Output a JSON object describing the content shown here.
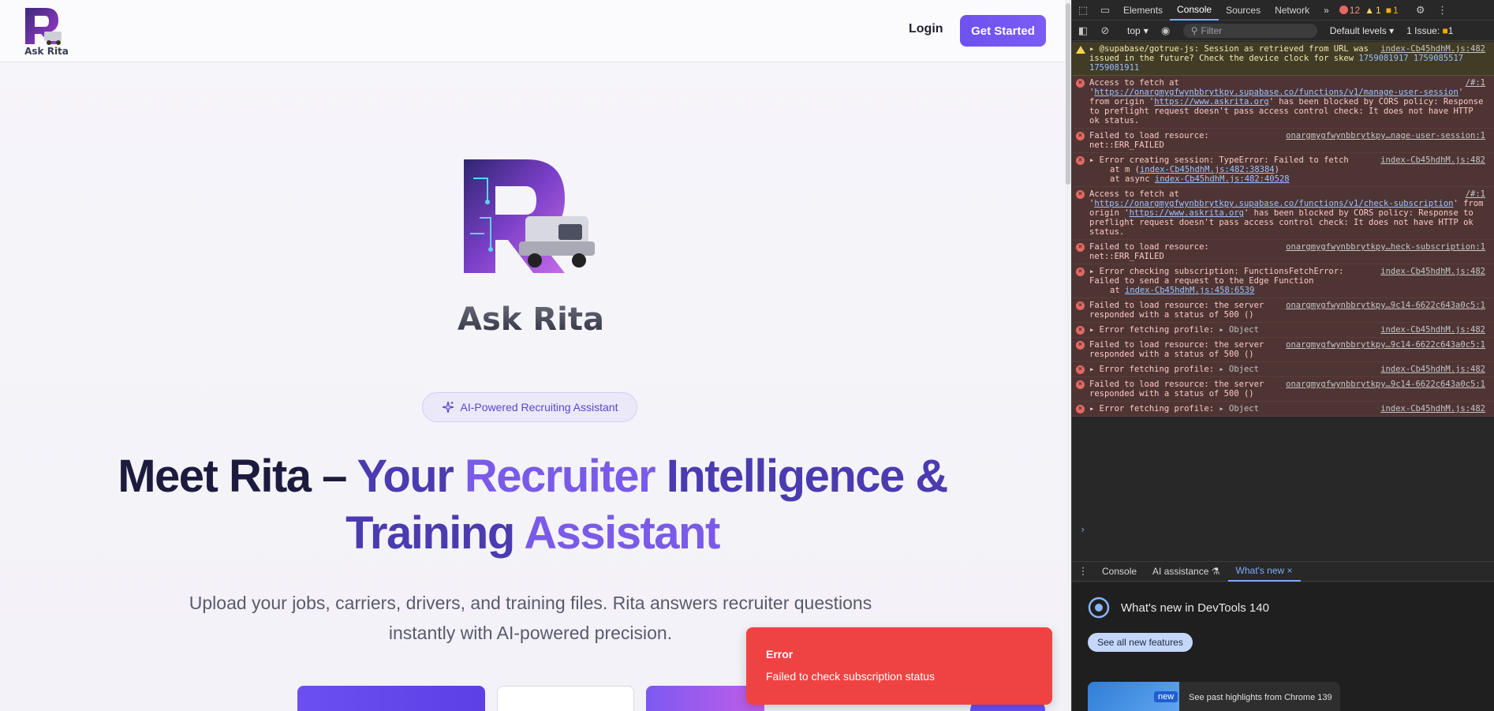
{
  "nav": {
    "logo_text": "Ask Rita",
    "login_label": "Login",
    "get_started_label": "Get Started"
  },
  "hero": {
    "logo_text": "Ask Rita",
    "badge": "AI-Powered Recruiting Assistant",
    "headline_1a": "Meet Rita – ",
    "headline_1b": "Your ",
    "headline_1c": "Recruiter ",
    "headline_1d": "Intelligence &",
    "headline_2a": "Training ",
    "headline_2b": "Assistant",
    "subtext": "Upload your jobs, carriers, drivers, and training files. Rita answers recruiter questions instantly with AI-powered precision."
  },
  "toast": {
    "title": "Error",
    "message": "Failed to check subscription status"
  },
  "devtools": {
    "tabs": [
      "Elements",
      "Console",
      "Sources",
      "Network"
    ],
    "more": "»",
    "error_count": "12",
    "warn_count": "1",
    "info_count": "1",
    "context": "top",
    "filter_placeholder": "Filter",
    "levels": "Default levels",
    "issues": "1 Issue:",
    "issues_count": "1",
    "console_prompt": "›",
    "drawer_tabs": {
      "console": "Console",
      "ai": "AI assistance",
      "whats_new": "What's new"
    },
    "whats_new": {
      "title": "What's new in DevTools 140",
      "button": "See all new features",
      "card_badge": "new",
      "card_text": "See past highlights from Chrome 139"
    },
    "messages": {
      "m1": {
        "text": "▸ @supabase/gotrue-js: Session as retrieved from URL was issued in the future? Check the device clock for skew",
        "nums": "1759081917 1759085517 1759081911",
        "src": "index-Cb45hdhM.js:482"
      },
      "m2": {
        "a": "Access to fetch at '",
        "url": "https://onargmygfwynbbrytkpy.supabase.co/functions/v1/manage-user-session",
        "b": "' from origin '",
        "origin": "https://www.askrita.org",
        "c": "' has been blocked by CORS policy: Response to preflight request doesn't pass access control check: It does not have HTTP ok status.",
        "src": "/#:1"
      },
      "m3": {
        "text": "Failed to load resource: net::ERR_FAILED",
        "src": "onargmygfwynbbrytkpy…nage-user-session:1"
      },
      "m4": {
        "text": "▸ Error creating session: TypeError: Failed to fetch",
        "line2a": "at m (",
        "line2link": "index-Cb45hdhM.js:482:38384",
        "line2b": ")",
        "line3a": "at async ",
        "line3link": "index-Cb45hdhM.js:482:40528",
        "src": "index-Cb45hdhM.js:482"
      },
      "m5": {
        "a": "Access to fetch at '",
        "url": "https://onargmygfwynbbrytkpy.supabase.co/functions/v1/check-subscription",
        "b": "' from origin '",
        "origin": "https://www.askrita.org",
        "c": "' has been blocked by CORS policy: Response to preflight request doesn't pass access control check: It does not have HTTP ok status.",
        "src": "/#:1"
      },
      "m6": {
        "text": "Failed to load resource: net::ERR_FAILED",
        "src": "onargmygfwynbbrytkpy…heck-subscription:1"
      },
      "m7": {
        "text": "▸ Error checking subscription: FunctionsFetchError: Failed to send a request to the Edge Function",
        "line2a": "at ",
        "line2link": "index-Cb45hdhM.js:458:6539",
        "src": "index-Cb45hdhM.js:482"
      },
      "m8": {
        "text": "Failed to load resource: the server responded with a status of 500 ()",
        "src": "onargmygfwynbbrytkpy…9c14-6622c643a0c5:1"
      },
      "m9": {
        "text": "▸ Error fetching profile:",
        "obj": "▸ Object",
        "src": "index-Cb45hdhM.js:482"
      },
      "m10": {
        "text": "Failed to load resource: the server responded with a status of 500 ()",
        "src": "onargmygfwynbbrytkpy…9c14-6622c643a0c5:1"
      },
      "m11": {
        "text": "▸ Error fetching profile:",
        "obj": "▸ Object",
        "src": "index-Cb45hdhM.js:482"
      },
      "m12": {
        "text": "Failed to load resource: the server responded with a status of 500 ()",
        "src": "onargmygfwynbbrytkpy…9c14-6622c643a0c5:1"
      },
      "m13": {
        "text": "▸ Error fetching profile:",
        "obj": "▸ Object",
        "src": "index-Cb45hdhM.js:482"
      }
    }
  },
  "colors": {
    "brand_purple": "#6d52f0",
    "toast_red": "#ef4343",
    "error_bg": "#4e3534",
    "warn_bg": "#413c26"
  }
}
